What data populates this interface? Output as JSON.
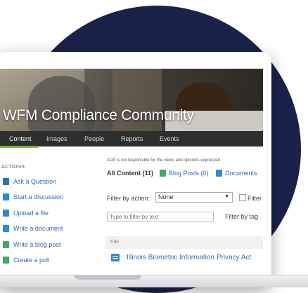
{
  "banner": {
    "title": "WFM Compliance Community"
  },
  "nav": {
    "items": [
      "Content",
      "Images",
      "People",
      "Reports",
      "Events"
    ],
    "active": "Content"
  },
  "sidebar": {
    "heading": "ACTIONS",
    "actions": [
      {
        "label": "Ask a Question",
        "icon": "question-icon",
        "color": "#2a6db6"
      },
      {
        "label": "Start a discussion",
        "icon": "discussion-icon",
        "color": "#2a8ad6"
      },
      {
        "label": "Upload a file",
        "icon": "upload-file-icon",
        "color": "#2a8ad6"
      },
      {
        "label": "Write a document",
        "icon": "document-icon",
        "color": "#2a8ad6"
      },
      {
        "label": "Write a blog post",
        "icon": "blog-post-icon",
        "color": "#3aa866"
      },
      {
        "label": "Create a poll",
        "icon": "poll-icon",
        "color": "#3aa866"
      }
    ]
  },
  "main": {
    "disclaimer": "ADP is not responsible for the views and opinions expressed",
    "tabs": {
      "all": "All Content (11)",
      "blog": "Blog Posts (0)",
      "docs": "Documents"
    },
    "filter": {
      "label": "Filter by action:",
      "selected": "None",
      "checkbox_label": "Filter"
    },
    "text_filter": {
      "placeholder": "Type to filter by text"
    },
    "tag_filter": "Filter by tag",
    "table": {
      "header": "Title",
      "rows": [
        {
          "title": "Illinois Biometric Information Privacy Act"
        }
      ]
    }
  },
  "colors": {
    "accent": "#7bb244",
    "navy": "#1a2249",
    "link": "#2a6db6"
  }
}
